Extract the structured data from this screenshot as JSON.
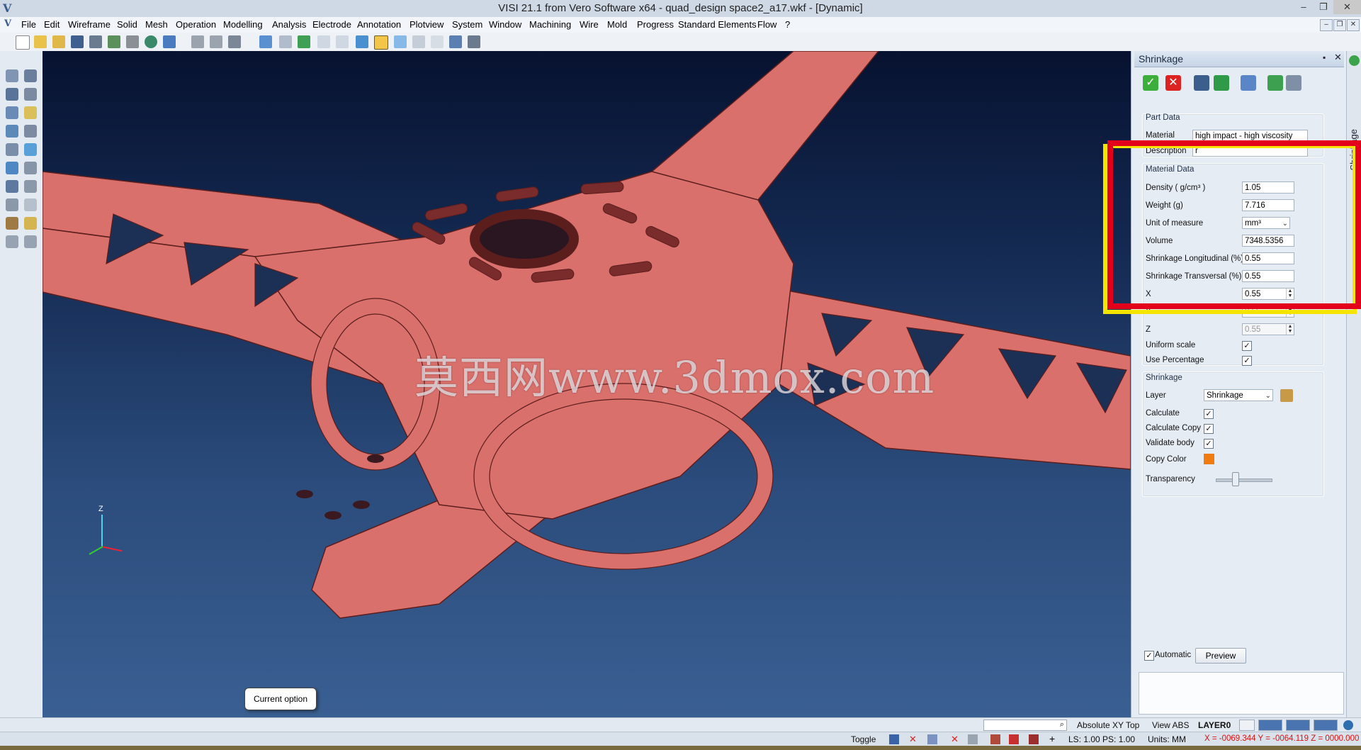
{
  "window": {
    "title": "VISI 21.1 from Vero Software x64 - quad_design space2_a17.wkf - [Dynamic]",
    "app_icon": "V",
    "controls": [
      "–",
      "❐",
      "✕"
    ],
    "mdi_controls": [
      "–",
      "❐",
      "✕"
    ]
  },
  "menu": [
    "File",
    "Edit",
    "Wireframe",
    "Solid",
    "Mesh",
    "Operation",
    "Modelling",
    "Analysis",
    "Electrode",
    "Annotation",
    "Plotview",
    "System",
    "Window",
    "Machining",
    "Wire",
    "Mold",
    "Progress",
    "Standard Elements",
    "Flow",
    "?"
  ],
  "viewport": {
    "watermark": "莫西网www.3dmox.com",
    "tooltip": "Current option",
    "axis_label": "Z",
    "part_color": "#d9706c",
    "edge_color": "#5c1d1d"
  },
  "panel": {
    "title": "Shrinkage",
    "header_buttons": [
      "▪",
      "✕"
    ],
    "side_tab": "Shrinkage",
    "part_data": {
      "title": "Part Data",
      "material_label": "Material",
      "material_value": "high impact - high viscosity",
      "description_label": "Description",
      "description_value": "r"
    },
    "material_data": {
      "title": "Material Data",
      "rows": [
        {
          "label": "Density ( g/cm³ )",
          "value": "1.05"
        },
        {
          "label": "Weight (g)",
          "value": "7.716"
        },
        {
          "label": "Unit of measure",
          "value": "mm³"
        },
        {
          "label": "Volume",
          "value": "7348.5356"
        },
        {
          "label": "Shrinkage Longitudinal (%)",
          "value": "0.55"
        },
        {
          "label": "Shrinkage Transversal (%)",
          "value": "0.55"
        },
        {
          "label": "X",
          "value": "0.55"
        },
        {
          "label": "Y",
          "value": "0.55"
        },
        {
          "label": "Z",
          "value": "0.55"
        }
      ],
      "uniform_scale_label": "Uniform scale",
      "use_percentage_label": "Use Percentage"
    },
    "shrinkage": {
      "title": "Shrinkage",
      "layer_label": "Layer",
      "layer_value": "Shrinkage",
      "calculate_label": "Calculate",
      "calculate_copy_label": "Calculate Copy",
      "validate_body_label": "Validate body",
      "copy_color_label": "Copy Color",
      "copy_color": "#f07c10",
      "transparency_label": "Transparency"
    },
    "automatic_label": "Automatic",
    "preview_label": "Preview",
    "check_mark": "✓"
  },
  "status": {
    "ref": "Absolute XY Top",
    "view": "View ABS",
    "layer": "LAYER0",
    "toggle": "Toggle",
    "ls_ps": "LS: 1.00 PS: 1.00",
    "units": "Units: MM",
    "coords": "X = -0069.344 Y = -0064.119 Z = 0000.000"
  }
}
